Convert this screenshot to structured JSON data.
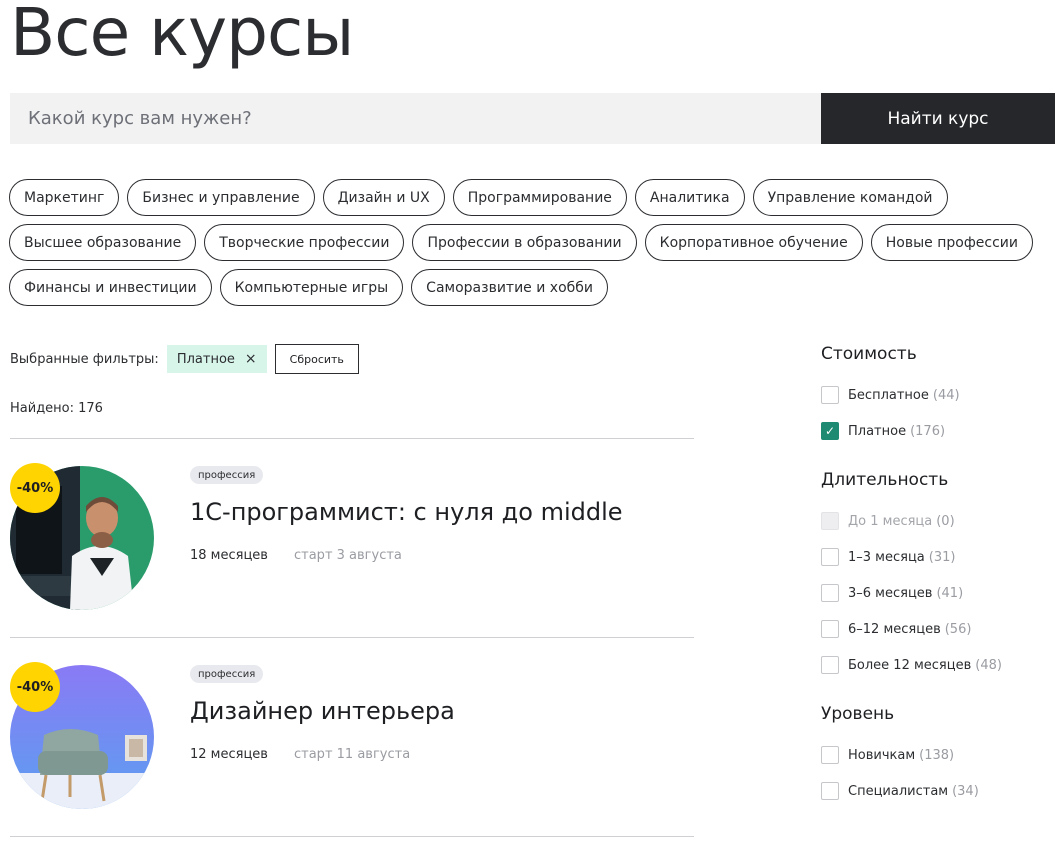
{
  "page": {
    "title": "Все курсы"
  },
  "search": {
    "placeholder": "Какой курс вам нужен?",
    "button": "Найти курс"
  },
  "categories": {
    "row1": [
      "Маркетинг",
      "Бизнес и управление",
      "Дизайн и UX",
      "Программирование",
      "Аналитика",
      "Управление командой"
    ],
    "row2": [
      "Высшее образование",
      "Творческие профессии",
      "Профессии в образовании",
      "Корпоративное обучение",
      "Новые профессии"
    ],
    "row3": [
      "Финансы и инвестиции",
      "Компьютерные игры",
      "Саморазвитие и хобби"
    ]
  },
  "filters": {
    "label": "Выбранные фильтры:",
    "active": "Платное",
    "remove_icon": "×",
    "reset": "Сбросить"
  },
  "found": "Найдено: 176",
  "courses": [
    {
      "discount": "-40%",
      "tag": "профессия",
      "title": "1С-программист: с нуля до middle",
      "duration": "18 месяцев",
      "start": "старт 3 августа",
      "image_bg": "#2a9c6c"
    },
    {
      "discount": "-40%",
      "tag": "профессия",
      "title": "Дизайнер интерьера",
      "duration": "12 месяцев",
      "start": "старт 11 августа",
      "image_bg": "#7a73f0"
    }
  ],
  "sidebar": {
    "cost": {
      "heading": "Стоимость",
      "options": [
        {
          "label": "Бесплатное",
          "count": "(44)",
          "checked": false
        },
        {
          "label": "Платное",
          "count": "(176)",
          "checked": true
        }
      ]
    },
    "duration": {
      "heading": "Длительность",
      "options": [
        {
          "label": "До 1 месяца",
          "count": "(0)",
          "disabled": true
        },
        {
          "label": "1–3 месяца",
          "count": "(31)"
        },
        {
          "label": "3–6 месяцев",
          "count": "(41)"
        },
        {
          "label": "6–12 месяцев",
          "count": "(56)"
        },
        {
          "label": "Более 12 месяцев",
          "count": "(48)"
        }
      ]
    },
    "level": {
      "heading": "Уровень",
      "options": [
        {
          "label": "Новичкам",
          "count": "(138)"
        },
        {
          "label": "Специалистам",
          "count": "(34)"
        }
      ]
    }
  },
  "colors": {
    "accent_check": "#1e8a72",
    "discount_badge": "#ffd400",
    "active_filter_bg": "#d8f5ea"
  }
}
